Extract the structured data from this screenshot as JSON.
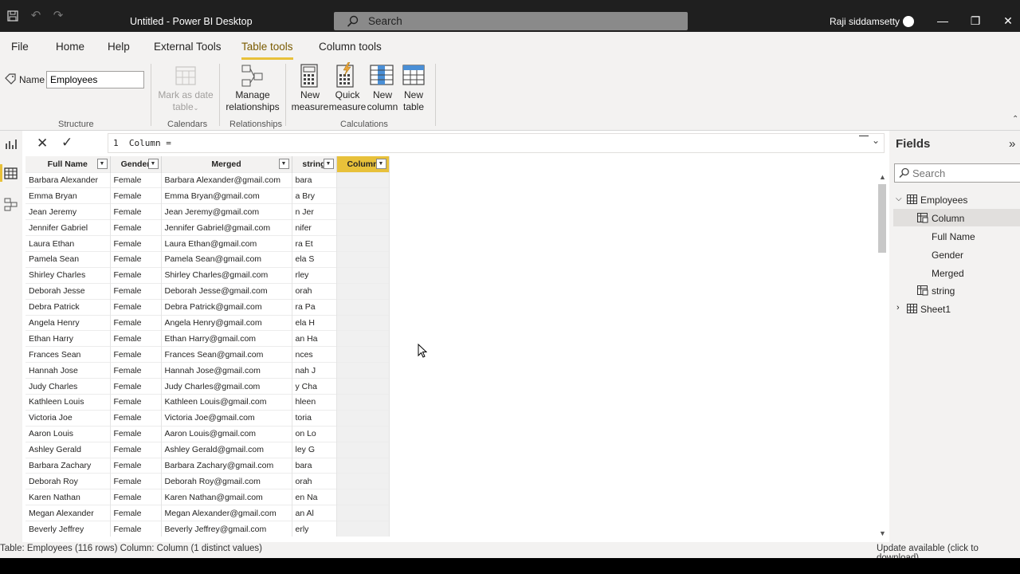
{
  "titlebar": {
    "app_title": "Untitled - Power BI Desktop",
    "search_label": "Search",
    "user_name": "Raji siddamsetty"
  },
  "tabs": [
    {
      "label": "File"
    },
    {
      "label": "Home"
    },
    {
      "label": "Help"
    },
    {
      "label": "External Tools"
    },
    {
      "label": "Table tools"
    },
    {
      "label": "Column tools"
    }
  ],
  "ribbon": {
    "name_label": "Name",
    "name_value": "Employees",
    "structure_label": "Structure",
    "mark_date_label_1": "Mark as date",
    "mark_date_label_2": "table",
    "calendars_label": "Calendars",
    "manage_rel_1": "Manage",
    "manage_rel_2": "relationships",
    "relationships_label": "Relationships",
    "new_measure_1": "New",
    "new_measure_2": "measure",
    "quick_measure_1": "Quick",
    "quick_measure_2": "measure",
    "new_column_1": "New",
    "new_column_2": "column",
    "new_table_1": "New",
    "new_table_2": "table",
    "calculations_label": "Calculations"
  },
  "formula": {
    "line_number": "1",
    "text": "Column ="
  },
  "grid": {
    "headers": [
      "Full Name",
      "Gender",
      "Merged",
      "string",
      "Column"
    ],
    "rows": [
      [
        "Barbara Alexander",
        "Female",
        "Barbara Alexander@gmail.com",
        "bara",
        ""
      ],
      [
        "Emma Bryan",
        "Female",
        "Emma Bryan@gmail.com",
        "a Bry",
        ""
      ],
      [
        "Jean Jeremy",
        "Female",
        "Jean Jeremy@gmail.com",
        "n Jer",
        ""
      ],
      [
        "Jennifer Gabriel",
        "Female",
        "Jennifer Gabriel@gmail.com",
        "nifer",
        ""
      ],
      [
        "Laura Ethan",
        "Female",
        "Laura Ethan@gmail.com",
        "ra Et",
        ""
      ],
      [
        "Pamela Sean",
        "Female",
        "Pamela Sean@gmail.com",
        "ela S",
        ""
      ],
      [
        "Shirley Charles",
        "Female",
        "Shirley Charles@gmail.com",
        "rley",
        ""
      ],
      [
        "Deborah Jesse",
        "Female",
        "Deborah Jesse@gmail.com",
        "orah",
        ""
      ],
      [
        "Debra Patrick",
        "Female",
        "Debra Patrick@gmail.com",
        "ra Pa",
        ""
      ],
      [
        "Angela Henry",
        "Female",
        "Angela Henry@gmail.com",
        "ela H",
        ""
      ],
      [
        "Ethan Harry",
        "Female",
        "Ethan Harry@gmail.com",
        "an Ha",
        ""
      ],
      [
        "Frances Sean",
        "Female",
        "Frances Sean@gmail.com",
        "nces",
        ""
      ],
      [
        "Hannah Jose",
        "Female",
        "Hannah Jose@gmail.com",
        "nah J",
        ""
      ],
      [
        "Judy Charles",
        "Female",
        "Judy Charles@gmail.com",
        "y Cha",
        ""
      ],
      [
        "Kathleen Louis",
        "Female",
        "Kathleen Louis@gmail.com",
        "hleen",
        ""
      ],
      [
        "Victoria Joe",
        "Female",
        "Victoria Joe@gmail.com",
        "toria",
        ""
      ],
      [
        "Aaron Louis",
        "Female",
        "Aaron Louis@gmail.com",
        "on Lo",
        ""
      ],
      [
        "Ashley Gerald",
        "Female",
        "Ashley Gerald@gmail.com",
        "ley G",
        ""
      ],
      [
        "Barbara Zachary",
        "Female",
        "Barbara Zachary@gmail.com",
        "bara",
        ""
      ],
      [
        "Deborah Roy",
        "Female",
        "Deborah Roy@gmail.com",
        "orah",
        ""
      ],
      [
        "Karen Nathan",
        "Female",
        "Karen Nathan@gmail.com",
        "en Na",
        ""
      ],
      [
        "Megan Alexander",
        "Female",
        "Megan Alexander@gmail.com",
        "an Al",
        ""
      ],
      [
        "Beverly Jeffrey",
        "Female",
        "Beverly Jeffrey@gmail.com",
        "erly",
        ""
      ]
    ]
  },
  "fields": {
    "title": "Fields",
    "search_placeholder": "Search",
    "tables": [
      {
        "name": "Employees",
        "expanded": true,
        "children": [
          "Column",
          "Full Name",
          "Gender",
          "Merged",
          "string"
        ]
      },
      {
        "name": "Sheet1",
        "expanded": false,
        "children": []
      }
    ]
  },
  "status": {
    "left": "Table: Employees (116 rows) Column: Column (1 distinct values)",
    "right": "Update available (click to download)"
  },
  "colors": {
    "accent": "#e8c13a",
    "titlebar_bg": "#1f1f1f",
    "ribbon_bg": "#f3f2f1"
  }
}
